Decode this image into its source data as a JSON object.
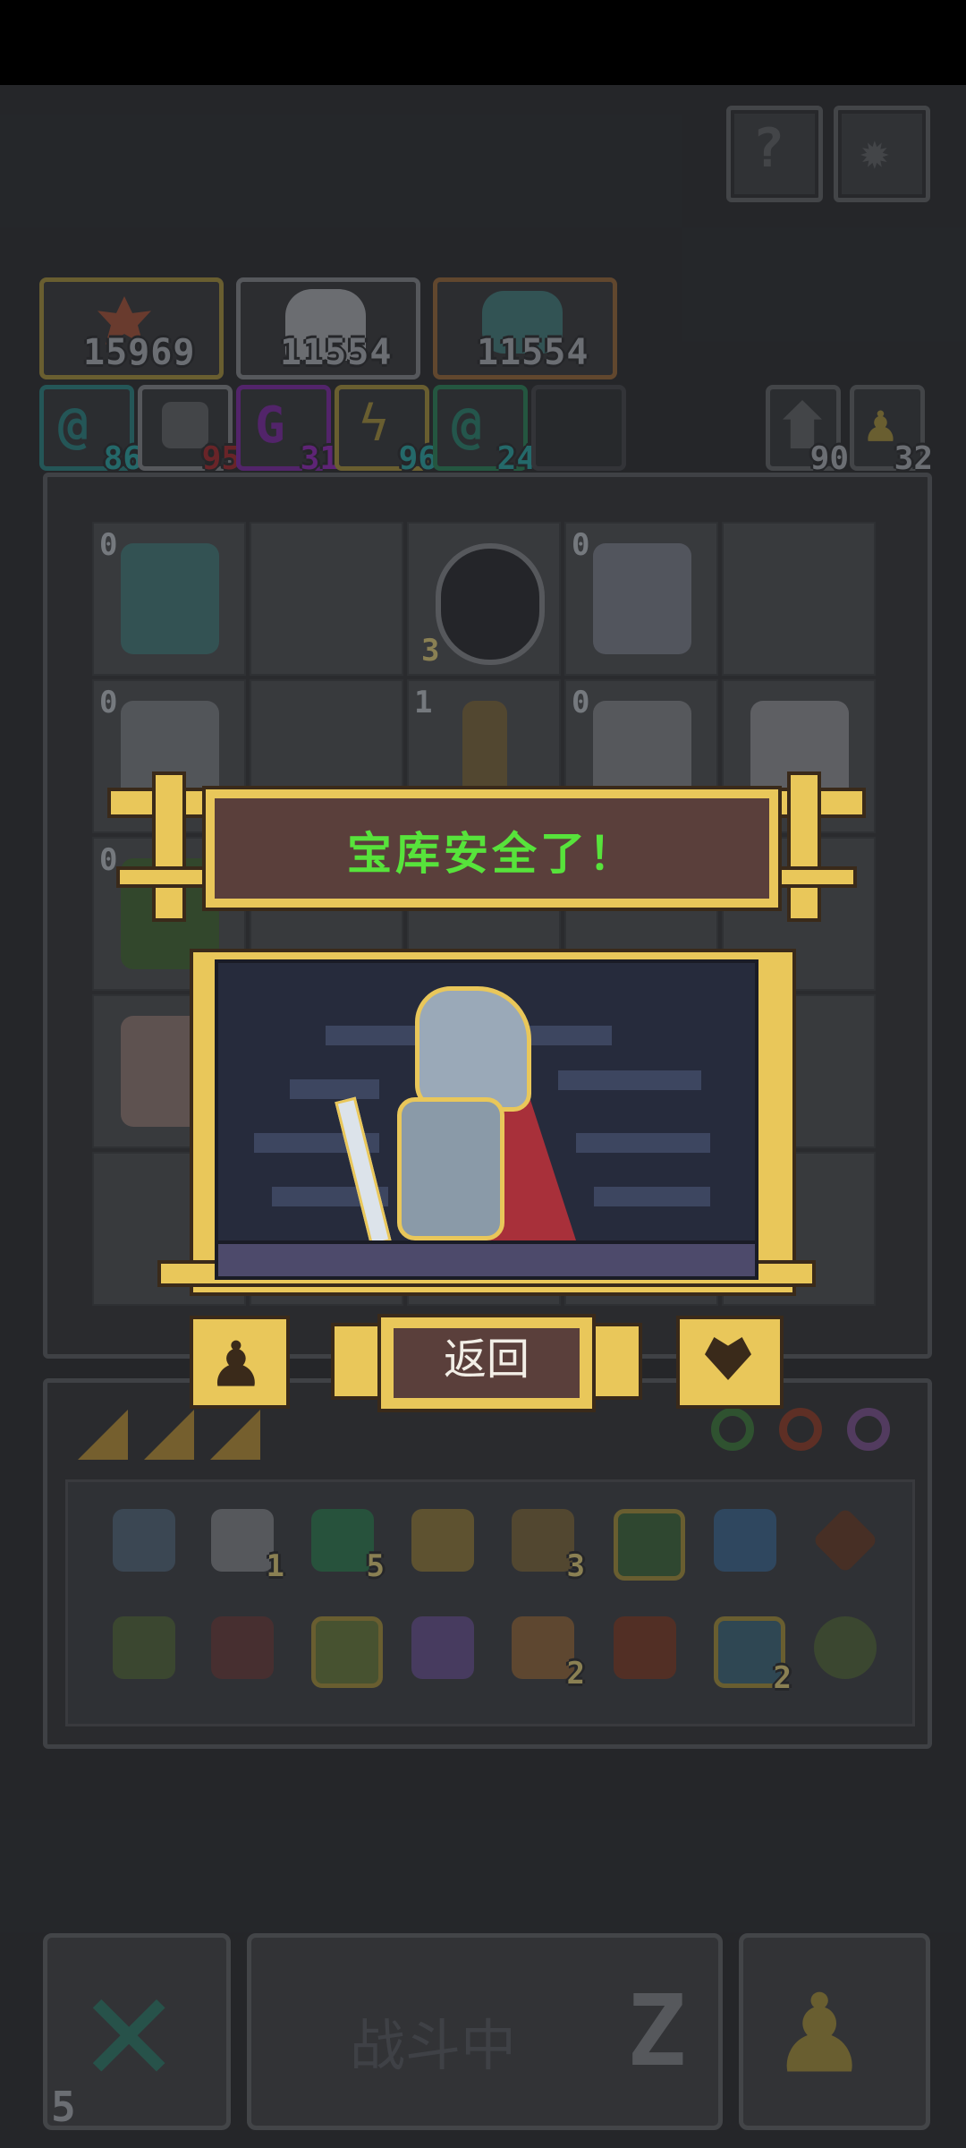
{
  "top_buttons": {
    "help_icon": "question-icon",
    "settings_icon": "gear-icon"
  },
  "bosses": [
    {
      "value": "15969",
      "border": "#b8953a"
    },
    {
      "value": "11554",
      "border": "#8a8d92"
    },
    {
      "value": "11554",
      "border": "#9a6a3a"
    }
  ],
  "gems": [
    {
      "value": "86",
      "color": "#2fa6a6"
    },
    {
      "value": "95",
      "color": "#b0343a"
    },
    {
      "value": "31",
      "color": "#9a2fbf"
    },
    {
      "value": "96",
      "color": "#2fa6a6"
    },
    {
      "value": "24",
      "color": "#2fa6a6"
    }
  ],
  "counters": {
    "upgrade": "90",
    "pawn": "32"
  },
  "board": {
    "levels": [
      "0",
      "0",
      "0",
      "1",
      "0",
      "0"
    ],
    "counts": [
      "3"
    ]
  },
  "dialog": {
    "message": "宝库安全了！",
    "back_label": "返回"
  },
  "inventory": {
    "counts": [
      "1",
      "5",
      "3",
      "2",
      "2"
    ]
  },
  "bottom": {
    "cancel_count": "5",
    "fight_label": "战斗中"
  },
  "colors": {
    "gold": "#e9c75a",
    "banner": "#5a3f3b",
    "message": "#57e33b"
  }
}
